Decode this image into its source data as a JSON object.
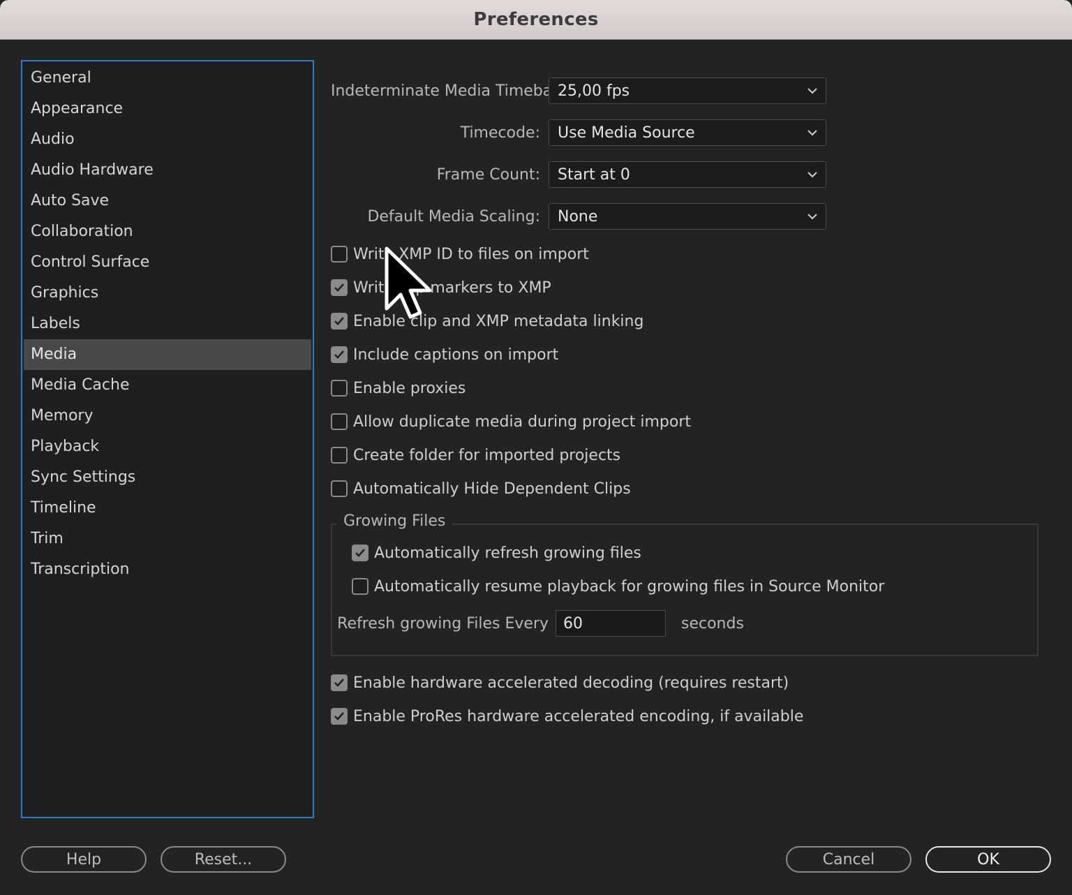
{
  "window": {
    "title": "Preferences"
  },
  "sidebar": {
    "items": [
      {
        "label": "General"
      },
      {
        "label": "Appearance"
      },
      {
        "label": "Audio"
      },
      {
        "label": "Audio Hardware"
      },
      {
        "label": "Auto Save"
      },
      {
        "label": "Collaboration"
      },
      {
        "label": "Control Surface"
      },
      {
        "label": "Graphics"
      },
      {
        "label": "Labels"
      },
      {
        "label": "Media"
      },
      {
        "label": "Media Cache"
      },
      {
        "label": "Memory"
      },
      {
        "label": "Playback"
      },
      {
        "label": "Sync Settings"
      },
      {
        "label": "Timeline"
      },
      {
        "label": "Trim"
      },
      {
        "label": "Transcription"
      }
    ],
    "selected": "Media"
  },
  "settings": {
    "timebase": {
      "label": "Indeterminate Media Timebase:",
      "value": "25,00 fps"
    },
    "timecode": {
      "label": "Timecode:",
      "value": "Use Media Source"
    },
    "frame_count": {
      "label": "Frame Count:",
      "value": "Start at 0"
    },
    "scaling": {
      "label": "Default Media Scaling:",
      "value": "None"
    }
  },
  "checkboxes": [
    {
      "label": "Write XMP ID to files on import",
      "checked": false
    },
    {
      "label": "Write clip markers to XMP",
      "checked": true
    },
    {
      "label": "Enable clip and XMP metadata linking",
      "checked": true
    },
    {
      "label": "Include captions on import",
      "checked": true
    },
    {
      "label": "Enable proxies",
      "checked": false
    },
    {
      "label": "Allow duplicate media during project import",
      "checked": false
    },
    {
      "label": "Create folder for imported projects",
      "checked": false
    },
    {
      "label": "Automatically Hide Dependent Clips",
      "checked": false
    }
  ],
  "growing_files": {
    "title": "Growing Files",
    "auto_refresh": {
      "label": "Automatically refresh growing files",
      "checked": true
    },
    "auto_resume": {
      "label": "Automatically resume playback for growing files in Source Monitor",
      "checked": false
    },
    "refresh_label": "Refresh growing Files Every",
    "refresh_value": "60",
    "seconds_label": "seconds"
  },
  "hardware": [
    {
      "label": "Enable hardware accelerated decoding (requires restart)",
      "checked": true
    },
    {
      "label": "Enable ProRes hardware accelerated encoding, if available",
      "checked": true
    }
  ],
  "buttons": {
    "help": "Help",
    "reset": "Reset...",
    "cancel": "Cancel",
    "ok": "OK"
  },
  "colors": {
    "accent": "#2d7cd0",
    "selected_bg": "#484848",
    "background": "#232323"
  },
  "icons": {
    "dropdown": "chevron-down-icon",
    "check": "checkmark-icon",
    "cursor": "mouse-pointer-icon"
  }
}
